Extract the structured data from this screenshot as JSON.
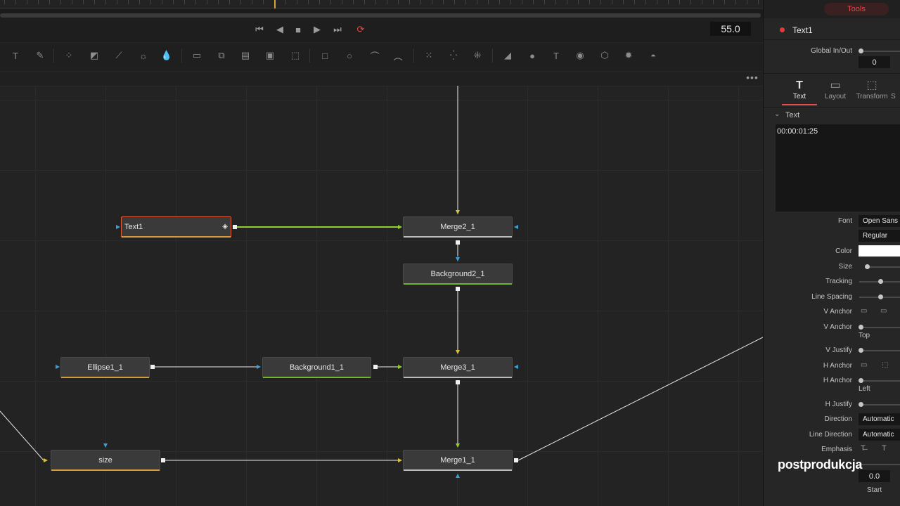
{
  "transport": {
    "timecode": "55.0",
    "buttons": [
      "go-to-start",
      "step-back",
      "stop",
      "play",
      "go-to-end",
      "loop"
    ]
  },
  "toolbar": {
    "tools": [
      "text-icon",
      "paint-icon",
      "particles-icon",
      "mask-gradient-icon",
      "color-curve-icon",
      "brightness-icon",
      "blur-drop-icon",
      "background-icon",
      "merge-icon",
      "loader-icon",
      "saver-icon",
      "transform-icon",
      "rectangle-icon",
      "ellipse-icon",
      "polygon-icon",
      "bspline-icon",
      "pemitter-icon",
      "prender-icon",
      "pmerge-icon",
      "shape3d-icon",
      "merge3d-icon",
      "text3d-icon",
      "camera3d-icon",
      "renderer3d-icon",
      "light3d-icon",
      "image-plane-icon"
    ]
  },
  "nodes": {
    "text1": "Text1",
    "merge2": "Merge2_1",
    "background2": "Background2_1",
    "ellipse1": "Ellipse1_1",
    "background1": "Background1_1",
    "merge3": "Merge3_1",
    "size": "size",
    "merge1": "Merge1_1"
  },
  "inspector": {
    "top_tab": "Tools",
    "tool_name": "Text1",
    "global_inout_label": "Global In/Out",
    "global_inout_value": "0",
    "tabs": [
      "Text",
      "Layout",
      "Transform",
      "S"
    ],
    "section": "Text",
    "styled_text": "00:00:01:25",
    "font_label": "Font",
    "font_value": "Open Sans",
    "style_value": "Regular",
    "color_label": "Color",
    "color_value": "#ffffff",
    "size_label": "Size",
    "tracking_label": "Tracking",
    "line_spacing_label": "Line Spacing",
    "v_anchor_label": "V Anchor",
    "v_anchor2_label": "V Anchor",
    "v_anchor_value": "Top",
    "v_justify_label": "V Justify",
    "h_anchor_label": "H Anchor",
    "h_anchor2_label": "H Anchor",
    "h_anchor_value": "Left",
    "h_justify_label": "H Justify",
    "direction_label": "Direction",
    "direction_value": "Automatic",
    "line_direction_label": "Line Direction",
    "line_direction_value": "Automatic",
    "emphasis_label": "Emphasis",
    "start_value": "0.0",
    "start_label": "Start"
  },
  "watermark": "postprodukcja",
  "colors": {
    "accent_red": "#e23b3b",
    "link_green": "#8fd12a",
    "link_white": "#e8e8e8",
    "input_yellow": "#d8c23a",
    "input_blue": "#3aa0d8",
    "bar_green": "#6fb62c",
    "bar_orange": "#d79a3a"
  }
}
